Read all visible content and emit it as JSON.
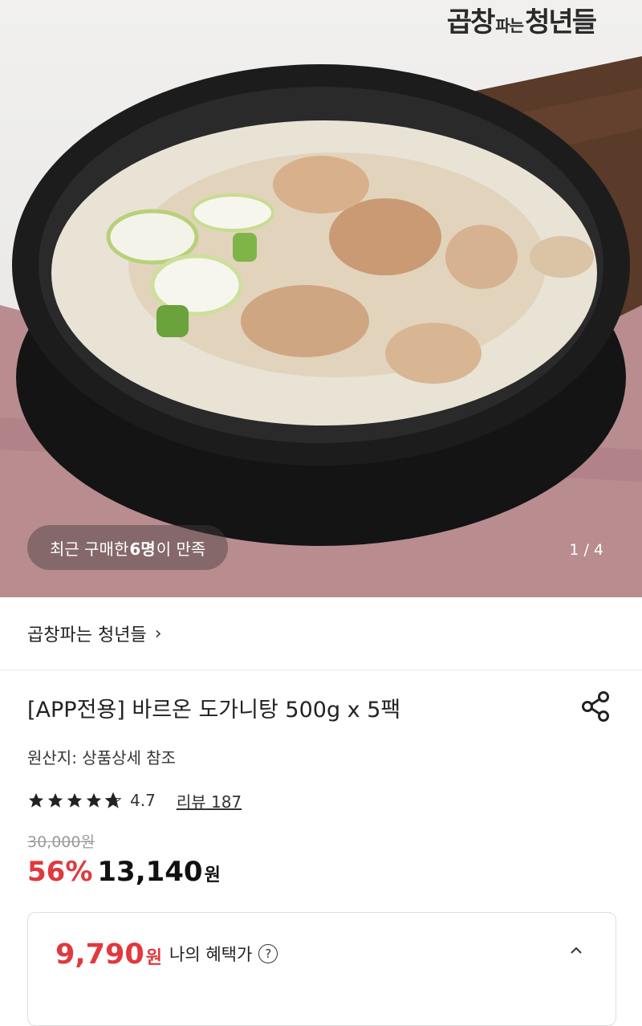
{
  "hero": {
    "brand_logo": {
      "main1": "곱창",
      "small": "파는",
      "main2": "청년들"
    },
    "badge": {
      "prefix": "최근 구매한 ",
      "count": "6명",
      "suffix": "이 만족"
    },
    "pager": "1 / 4"
  },
  "seller": {
    "name": "곱창파는 청년들",
    "chevron": "›"
  },
  "product": {
    "title": "[APP전용] 바르온 도가니탕 500g x 5팩",
    "origin": "원산지: 상품상세 참조",
    "rating": {
      "stars": 4.7,
      "value": "4.7",
      "review_label": "리뷰 187"
    },
    "original_price": "30,000원",
    "discount": "56%",
    "price": "13,140",
    "price_unit": "원"
  },
  "benefit": {
    "price": "9,790",
    "unit": "원",
    "label": "나의 혜택가",
    "help": "?",
    "collapse": "⌃"
  },
  "icons": {
    "share": "share-icon",
    "star": "star-icon",
    "help": "help-icon",
    "chevron_up": "chevron-up-icon"
  },
  "colors": {
    "accent": "#e0393e",
    "text": "#222222",
    "muted": "#9a9a9a"
  }
}
